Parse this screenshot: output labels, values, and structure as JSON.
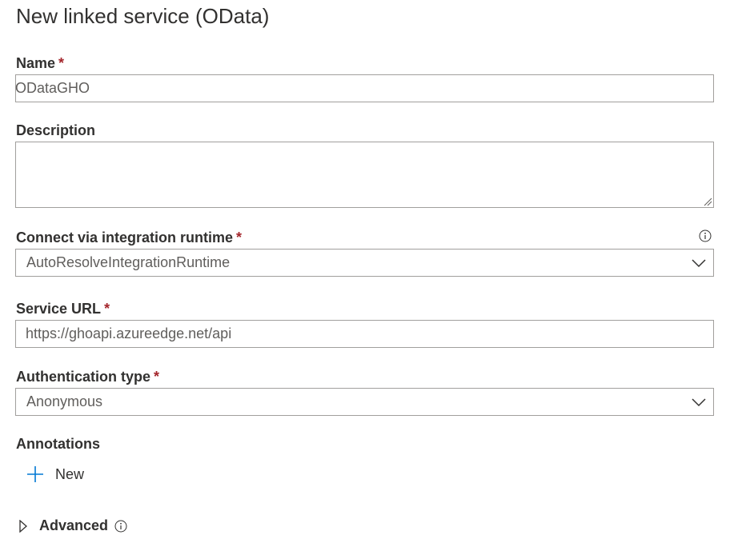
{
  "dialog": {
    "title": "New linked service (OData)"
  },
  "form": {
    "name": {
      "label": "Name",
      "required_mark": "*",
      "value": "ODataGHO"
    },
    "description": {
      "label": "Description",
      "value": ""
    },
    "integration_runtime": {
      "label": "Connect via integration runtime",
      "required_mark": "*",
      "selected": "AutoResolveIntegrationRuntime"
    },
    "service_url": {
      "label": "Service URL",
      "required_mark": "*",
      "value": "https://ghoapi.azureedge.net/api"
    },
    "authentication_type": {
      "label": "Authentication type",
      "required_mark": "*",
      "selected": "Anonymous"
    },
    "annotations": {
      "label": "Annotations",
      "new_label": "New"
    },
    "advanced": {
      "label": "Advanced"
    }
  },
  "colors": {
    "accent": "#0078d4",
    "required": "#a4262c",
    "border": "#a19f9d"
  },
  "icons": {
    "info": "info-icon",
    "chevron": "chevron-down-icon",
    "plus": "plus-icon",
    "expand": "caret-right-icon"
  }
}
